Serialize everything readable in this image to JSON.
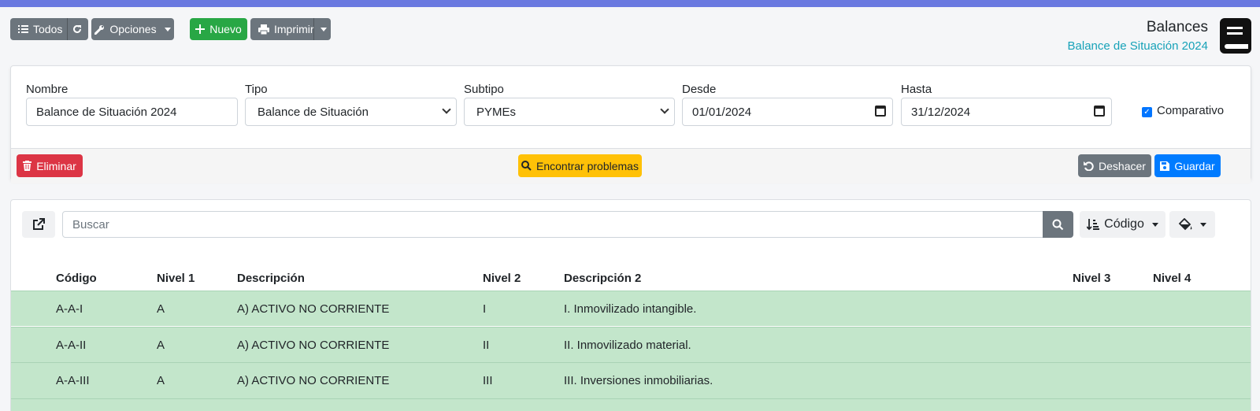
{
  "toolbar": {
    "all_label": "Todos",
    "options_label": "Opciones",
    "new_label": "Nuevo",
    "print_label": "Imprimir"
  },
  "header": {
    "title": "Balances",
    "subtitle": "Balance de Situación 2024"
  },
  "form": {
    "nombre_label": "Nombre",
    "nombre_value": "Balance de Situación 2024",
    "tipo_label": "Tipo",
    "tipo_value": "Balance de Situación",
    "subtipo_label": "Subtipo",
    "subtipo_value": "PYMEs",
    "desde_label": "Desde",
    "desde_value": "01/01/2024",
    "hasta_label": "Hasta",
    "hasta_value": "31/12/2024",
    "comparativo_label": "Comparativo",
    "comparativo_checked": true
  },
  "actions": {
    "delete_label": "Eliminar",
    "find_problems_label": "Encontrar problemas",
    "undo_label": "Deshacer",
    "save_label": "Guardar"
  },
  "list": {
    "search_placeholder": "Buscar",
    "sort_label": "Código",
    "columns": [
      "Código",
      "Nivel 1",
      "Descripción",
      "Nivel 2",
      "Descripción 2",
      "Nivel 3",
      "Nivel 4"
    ],
    "rows": [
      {
        "codigo": "A-A-I",
        "nivel1": "A",
        "descripcion": "A) ACTIVO NO CORRIENTE",
        "nivel2": "I",
        "descripcion2": "I. Inmovilizado intangible."
      },
      {
        "codigo": "A-A-II",
        "nivel1": "A",
        "descripcion": "A) ACTIVO NO CORRIENTE",
        "nivel2": "II",
        "descripcion2": "II. Inmovilizado material."
      },
      {
        "codigo": "A-A-III",
        "nivel1": "A",
        "descripcion": "A) ACTIVO NO CORRIENTE",
        "nivel2": "III",
        "descripcion2": "III. Inversiones inmobiliarias."
      }
    ]
  },
  "colors": {
    "topbar": "#6a79e0",
    "row_highlight": "#c3e6cb",
    "subtitle": "#17a2b8"
  }
}
